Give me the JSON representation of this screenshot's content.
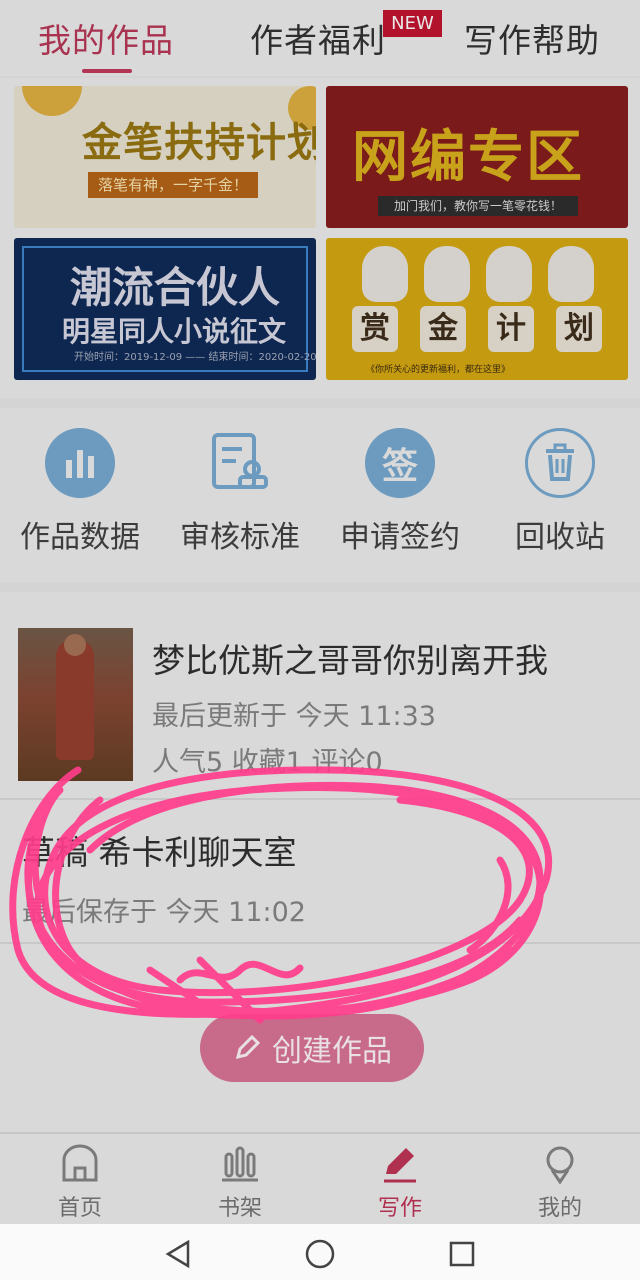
{
  "tabs": [
    {
      "label": "我的作品",
      "active": true
    },
    {
      "label": "作者福利",
      "active": false,
      "badge": "NEW"
    },
    {
      "label": "写作帮助",
      "active": false
    }
  ],
  "banners": {
    "b1": {
      "title": "金笔扶持计划",
      "subtitle": "落笔有神，一字千金！"
    },
    "b2": {
      "title": "网编专区",
      "subtitle": "加门我们，教你写一笔零花钱！"
    },
    "b3": {
      "title": "潮流合伙人",
      "subtitle": "明星同人小说征文",
      "dates": "开始时间：2019-12-09 —— 结束时间：2020-02-20"
    },
    "b4": {
      "chars": [
        "赏",
        "金",
        "计",
        "划"
      ],
      "note": "《你所关心的更新福利，都在这里》"
    }
  },
  "quick_actions": [
    {
      "label": "作品数据",
      "icon": "bar-chart-icon"
    },
    {
      "label": "审核标准",
      "icon": "document-stamp-icon"
    },
    {
      "label": "申请签约",
      "icon": "sign-icon",
      "icon_text": "签"
    },
    {
      "label": "回收站",
      "icon": "trash-icon"
    }
  ],
  "works": [
    {
      "title": "梦比优斯之哥哥你别离开我",
      "updated": "最后更新于 今天 11:33",
      "stats": "人气5 收藏1 评论0"
    },
    {
      "title": "草稿 希卡利聊天室",
      "saved": "最后保存于 今天 11:02"
    }
  ],
  "create_button": {
    "label": "创建作品"
  },
  "bottom_nav": [
    {
      "label": "首页",
      "icon": "home-icon",
      "active": false
    },
    {
      "label": "书架",
      "icon": "bookshelf-icon",
      "active": false
    },
    {
      "label": "写作",
      "icon": "pen-icon",
      "active": true
    },
    {
      "label": "我的",
      "icon": "profile-icon",
      "active": false
    }
  ],
  "colors": {
    "accent": "#b23556",
    "icon_blue": "#6c9bbf",
    "scribble": "#ff3d8b",
    "overlay_bg": "#d9d9d9"
  }
}
